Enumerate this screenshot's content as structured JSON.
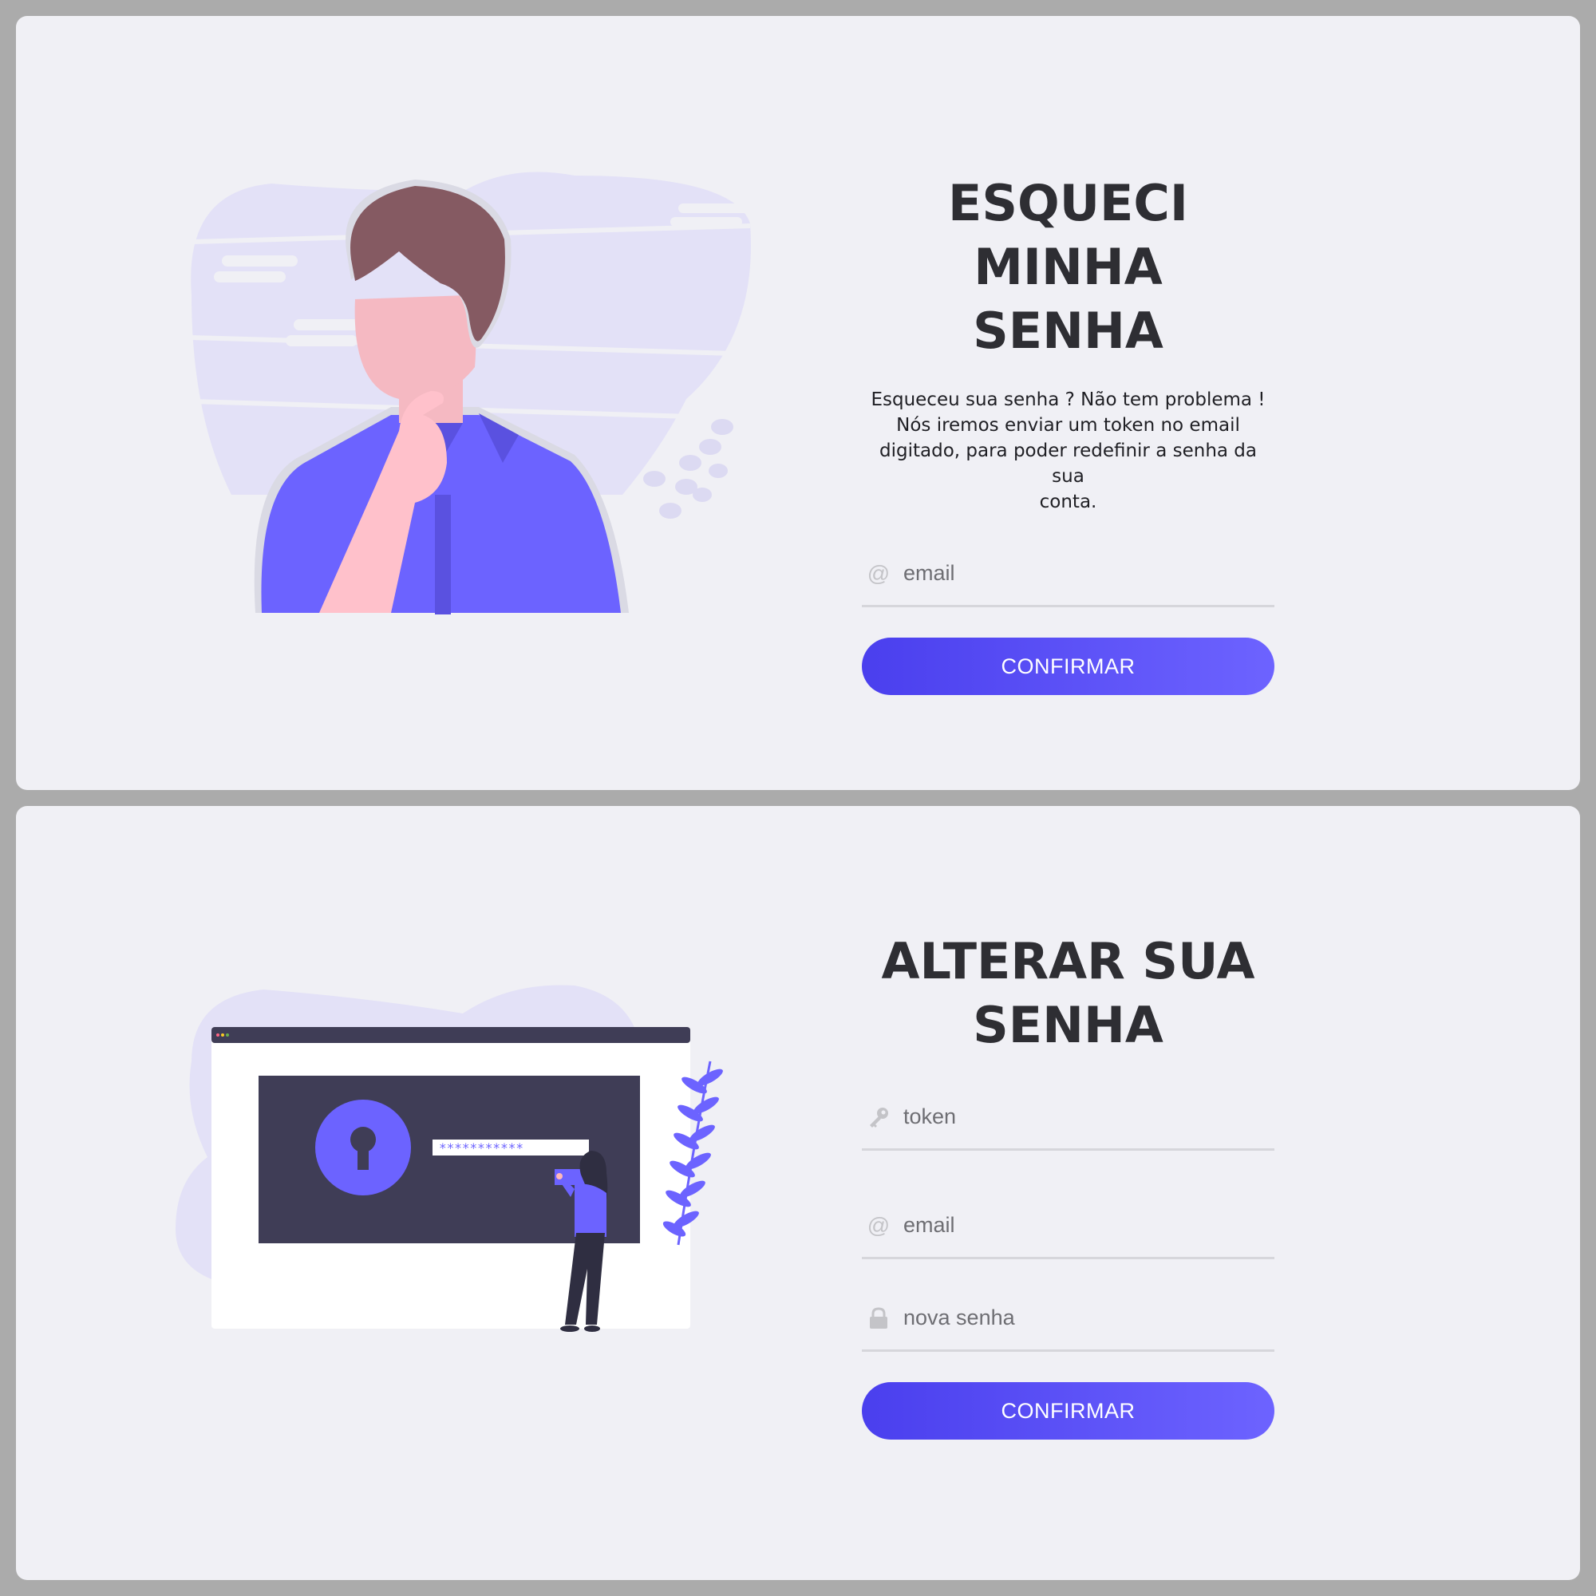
{
  "forgot": {
    "title_line1": "ESQUECI MINHA",
    "title_line2": "SENHA",
    "desc_line1": "Esqueceu sua senha ? Não tem problema !",
    "desc_line2": "Nós iremos enviar um token no email",
    "desc_line3": "digitado, para poder redefinir a senha da sua",
    "desc_line4": "conta.",
    "email_placeholder": "email",
    "email_value": "",
    "email_icon": "at-icon",
    "confirm_label": "CONFIRMAR"
  },
  "reset": {
    "title_line1": "ALTERAR SUA",
    "title_line2": "SENHA",
    "token_placeholder": "token",
    "token_value": "",
    "token_icon": "key-icon",
    "email_placeholder": "email",
    "email_value": "",
    "email_icon": "at-icon",
    "password_placeholder": "nova senha",
    "password_value": "",
    "password_icon": "lock-icon",
    "confirm_label": "CONFIRMAR",
    "illustration_password_mask": "***********"
  },
  "colors": {
    "primary": "#4a3fee",
    "primary_light": "#6d63ff",
    "panel_bg": "#f0f0f5",
    "page_bg": "#ababab",
    "title": "#2e2e33"
  }
}
